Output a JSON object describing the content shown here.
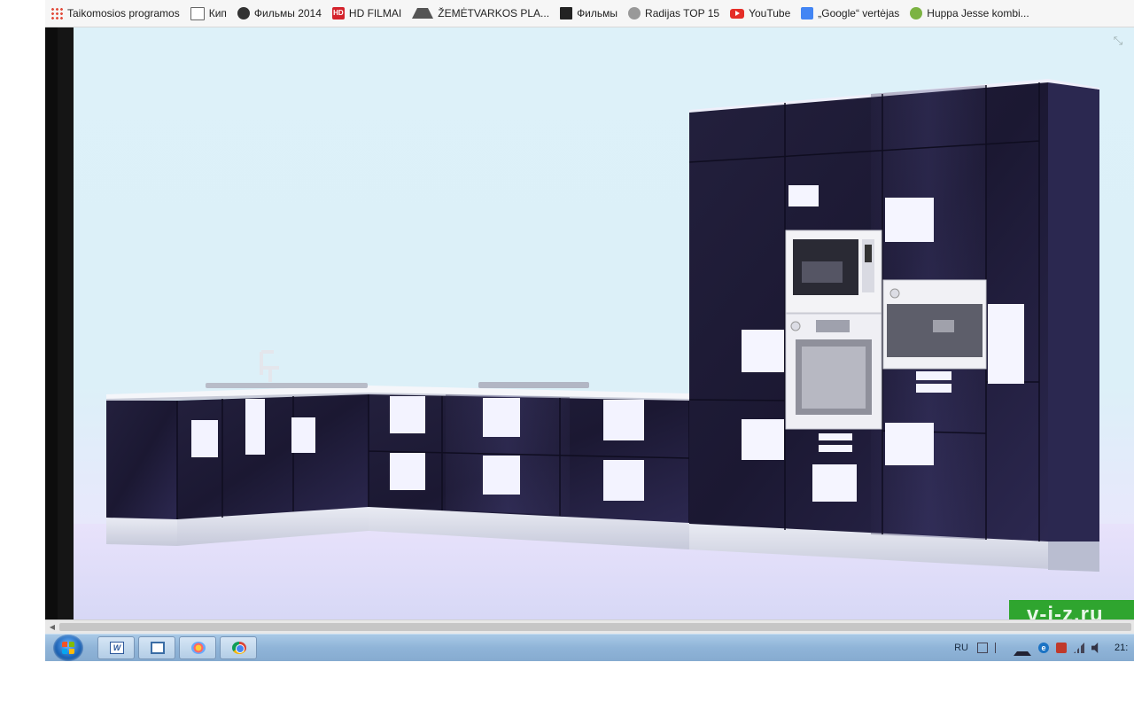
{
  "bookmarks": [
    {
      "label": "Taikomosios programos",
      "icon": "apps-grid-icon"
    },
    {
      "label": "Кип",
      "icon": "document-icon"
    },
    {
      "label": "Фильмы 2014",
      "icon": "film-reel-icon"
    },
    {
      "label": "HD FILMAI",
      "icon": "hd-icon"
    },
    {
      "label": "ŽEMĖTVARKOS PLA...",
      "icon": "triangle-icon"
    },
    {
      "label": "Фильмы",
      "icon": "tv-icon"
    },
    {
      "label": "Radijas TOP 15",
      "icon": "radio-icon"
    },
    {
      "label": "YouTube",
      "icon": "youtube-icon"
    },
    {
      "label": "„Google“ vertėjas",
      "icon": "google-translate-icon"
    },
    {
      "label": "Huppa Jesse kombi...",
      "icon": "huppa-icon"
    }
  ],
  "image": {
    "subject": "kitchen-render",
    "watermark": "v-i-z.ru",
    "colors": {
      "sky": "#ddf1f9",
      "cabinet": "#1d1a35",
      "cabinet_highlight": "#3b3766",
      "panel": "#f4f4ff",
      "plinth": "#d5d8e6"
    }
  },
  "taskbar": {
    "apps": [
      {
        "name": "word",
        "icon": "word-icon"
      },
      {
        "name": "window",
        "icon": "window-icon"
      },
      {
        "name": "paint",
        "icon": "paint-icon"
      },
      {
        "name": "chrome",
        "icon": "chrome-icon"
      }
    ],
    "tray": {
      "language": "RU",
      "clock": "21:"
    }
  }
}
